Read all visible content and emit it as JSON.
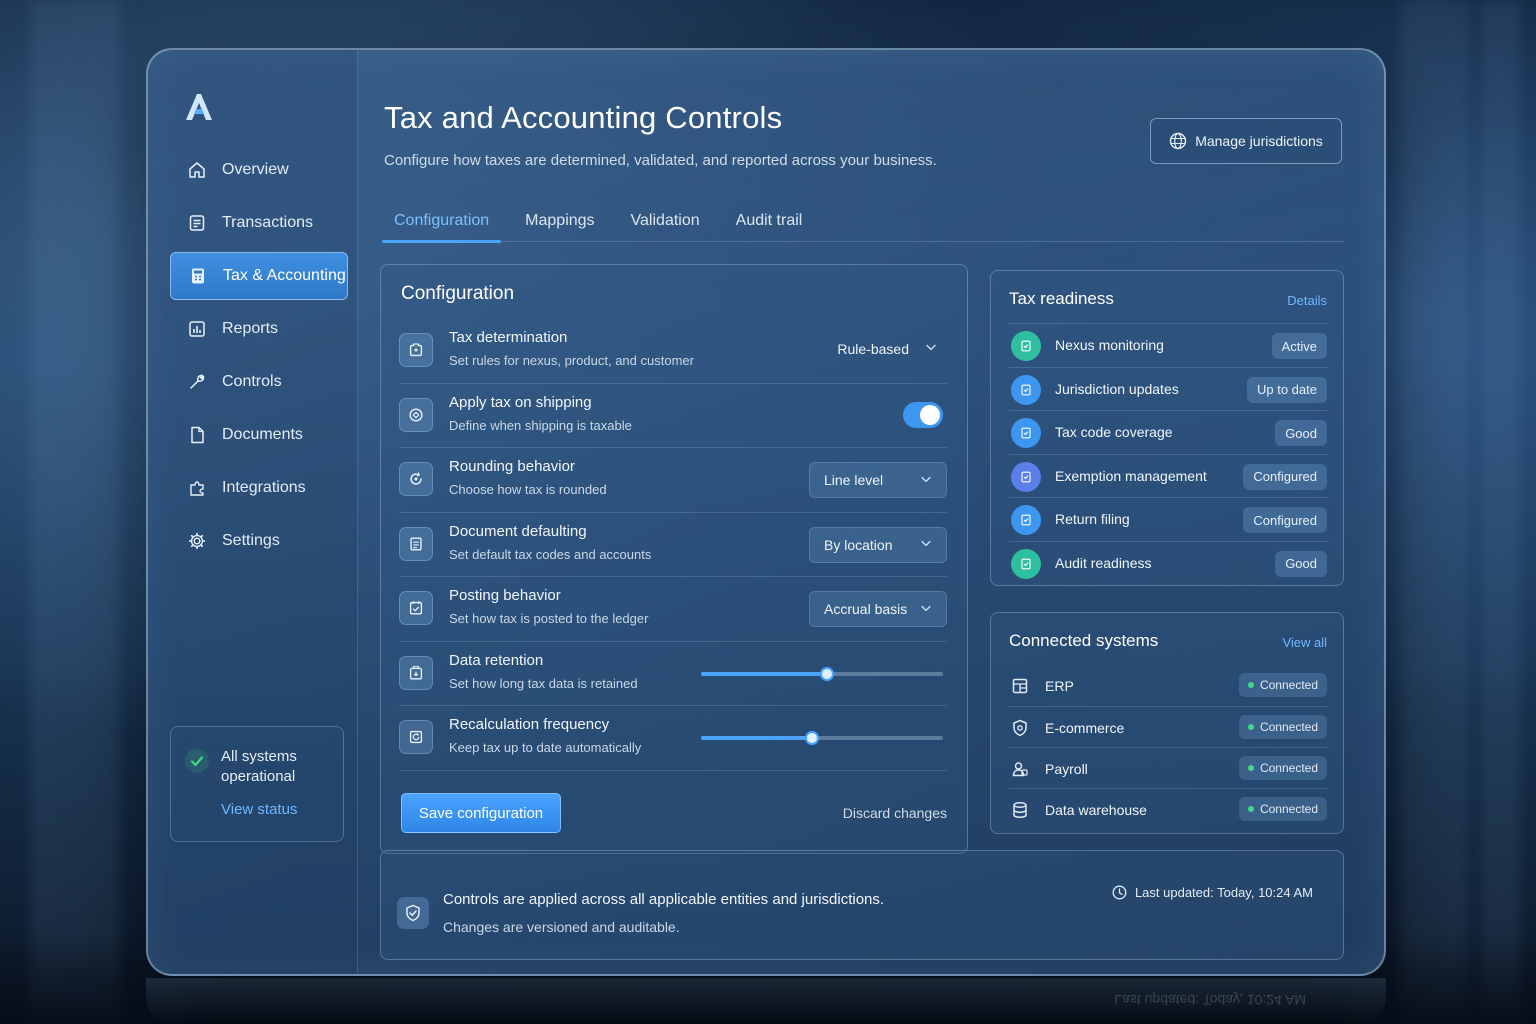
{
  "app": {
    "title": "Tax and Accounting Controls",
    "subtitle": "Configure how taxes are determined, validated, and reported across your business.",
    "logo_icon": "brand-logo-icon",
    "accent": "#4aa3ff"
  },
  "header": {
    "manage_label": "Manage jurisdictions",
    "manage_icon": "globe-icon"
  },
  "sidebar": {
    "items": [
      {
        "label": "Overview",
        "icon": "home-icon",
        "active": false
      },
      {
        "label": "Transactions",
        "icon": "receipt-icon",
        "active": false
      },
      {
        "label": "Tax & Accounting",
        "icon": "calculator-icon",
        "active": true
      },
      {
        "label": "Reports",
        "icon": "bar-chart-icon",
        "active": false
      },
      {
        "label": "Controls",
        "icon": "wrench-icon",
        "active": false
      },
      {
        "label": "Documents",
        "icon": "document-icon",
        "active": false
      },
      {
        "label": "Integrations",
        "icon": "puzzle-icon",
        "active": false
      },
      {
        "label": "Settings",
        "icon": "gear-icon",
        "active": false
      }
    ],
    "status": {
      "text": "All systems operational",
      "link": "View status"
    }
  },
  "tabs": [
    {
      "label": "Configuration",
      "active": true
    },
    {
      "label": "Mappings",
      "active": false
    },
    {
      "label": "Validation",
      "active": false
    },
    {
      "label": "Audit trail",
      "active": false
    }
  ],
  "config": {
    "title": "Configuration",
    "rows": [
      {
        "name": "Tax determination",
        "desc": "Set rules for nexus, product, and customer",
        "control": "plain-select",
        "value": "Rule-based",
        "icon": "building-icon"
      },
      {
        "name": "Apply tax on shipping",
        "desc": "Define when shipping is taxable",
        "control": "toggle",
        "on": true,
        "icon": "shipping-icon"
      },
      {
        "name": "Rounding behavior",
        "desc": "Choose how tax is rounded",
        "control": "select",
        "value": "Line level",
        "icon": "rounding-icon"
      },
      {
        "name": "Document defaulting",
        "desc": "Set default tax codes and accounts",
        "control": "select",
        "value": "By location",
        "icon": "file-icon"
      },
      {
        "name": "Posting behavior",
        "desc": "Set how tax is posted to the ledger",
        "control": "select",
        "value": "Accrual basis",
        "icon": "ledger-icon"
      },
      {
        "name": "Data retention",
        "desc": "Set how long tax data is retained",
        "control": "slider",
        "level": 0.52,
        "icon": "archive-icon"
      },
      {
        "name": "Recalculation frequency",
        "desc": "Keep tax up to date automatically",
        "control": "slider",
        "level": 0.46,
        "icon": "refresh-icon"
      }
    ],
    "save_label": "Save configuration",
    "discard_label": "Discard changes"
  },
  "readiness": {
    "title": "Tax readiness",
    "link": "Details",
    "items": [
      {
        "name": "Nexus monitoring",
        "status": "Active",
        "color": "#2fbfa0"
      },
      {
        "name": "Jurisdiction updates",
        "status": "Up to date",
        "color": "#3d96f0"
      },
      {
        "name": "Tax code coverage",
        "status": "Good",
        "color": "#3d96f0"
      },
      {
        "name": "Exemption management",
        "status": "Configured",
        "color": "#5a7fe8"
      },
      {
        "name": "Return filing",
        "status": "Configured",
        "color": "#3d96f0"
      },
      {
        "name": "Audit readiness",
        "status": "Good",
        "color": "#2fbfa0"
      }
    ]
  },
  "connected": {
    "title": "Connected systems",
    "link": "View all",
    "items": [
      {
        "name": "ERP",
        "status": "Connected",
        "icon": "erp-icon"
      },
      {
        "name": "E-commerce",
        "status": "Connected",
        "icon": "shield-bag-icon"
      },
      {
        "name": "Payroll",
        "status": "Connected",
        "icon": "payroll-icon"
      },
      {
        "name": "Data warehouse",
        "status": "Connected",
        "icon": "database-icon"
      }
    ]
  },
  "footer": {
    "line1": "Controls are applied across all applicable entities and jurisdictions.",
    "line2": "Changes are versioned and auditable.",
    "updated": "Last updated: Today, 10:24 AM"
  }
}
